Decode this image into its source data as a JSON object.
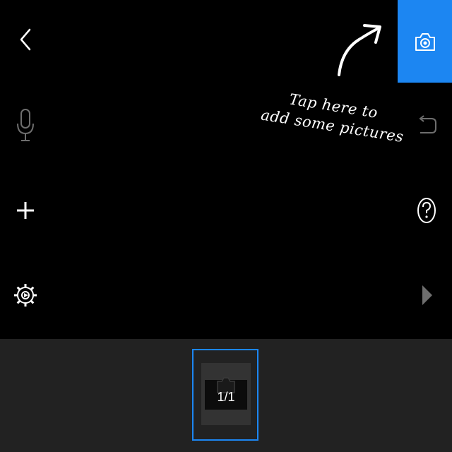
{
  "hint": {
    "line1": "Tap here to",
    "line2": "add some pictures"
  },
  "filmstrip": {
    "page_counter": "1/1"
  },
  "icons": {
    "back": "chevron-left-icon",
    "mic": "microphone-icon",
    "add": "plus-icon",
    "settings": "gear-icon",
    "camera": "camera-icon",
    "undo": "undo-icon",
    "help": "question-icon",
    "play": "play-icon",
    "arrow": "curved-arrow-icon"
  },
  "colors": {
    "accent": "#1c86f2",
    "background": "#000000",
    "filmstrip_bg": "#222222",
    "disabled_icon": "#6e6e6e"
  }
}
